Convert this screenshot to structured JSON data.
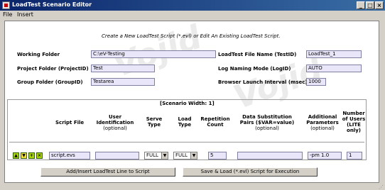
{
  "window": {
    "title": "LoadTest Scenario Editor",
    "minimize": "_",
    "maximize": "□",
    "close": "×"
  },
  "menu": {
    "file": "File",
    "insert": "Insert"
  },
  "intro": "Create a New LoadTest Script (*.evl) or Edit An Existing LoadTest Script.",
  "watermark": "Vojid",
  "form": {
    "working_folder": {
      "label": "Working Folder",
      "value": "C:\\eV-Testing"
    },
    "project_folder": {
      "label": "Project Folder (ProjectID)",
      "value": "Test"
    },
    "group_folder": {
      "label": "Group Folder (GroupID)",
      "value": "Testarea"
    },
    "file_name": {
      "label": "LoadTest File Name (TestID)",
      "value": "LoadTest_1"
    },
    "log_naming": {
      "label": "Log Naming Mode (LogID)",
      "value": "AUTO"
    },
    "browser_interval": {
      "label": "Browser Launch Interval (msec)",
      "value": "1000"
    }
  },
  "scenario": {
    "width_label": "[Scenario Width: 1]",
    "headers": {
      "script_file": "Script File",
      "user_id": "User Identification",
      "user_id_opt": "(optional)",
      "serve_type": "Serve Type",
      "load_type": "Load Type",
      "repetition": "Repetition Count",
      "data_sub": "Data Substitution Pairs ($VAR=value)",
      "data_sub_opt": "(optional)",
      "additional": "Additional Parameters",
      "additional_opt": "(optional)",
      "num_users": "Number of Users (LITE only)"
    },
    "row": {
      "script_file": "script.evs",
      "user_id": "",
      "serve_type": "FULL",
      "load_type": "FULL",
      "repetition": "5",
      "data_sub": "",
      "additional": "-pm 1.0",
      "num_users": "1"
    },
    "row_icons": {
      "up": "▲",
      "down": "▼",
      "add": "+",
      "delete": "×"
    }
  },
  "buttons": {
    "add_line": "Add/Insert LoadTest Line to Script",
    "save_load": "Save & Load (*.evl) Script for Execution"
  },
  "colors": {
    "title_start": "#0a246a",
    "title_end": "#3a6ea5",
    "field_bg": "#e8e6f8",
    "icon_green": "#a8d400"
  }
}
